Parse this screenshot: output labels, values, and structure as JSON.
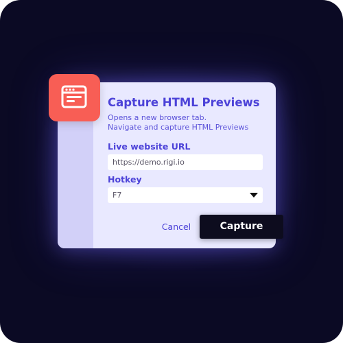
{
  "dialog": {
    "title": "Capture HTML Previews",
    "description_line1": "Opens a new browser tab.",
    "description_line2": "Navigate and capture HTML Previews",
    "icon": "browser-window-icon"
  },
  "form": {
    "url_label": "Live website URL",
    "url_value": "https://demo.rigi.io",
    "hotkey_label": "Hotkey",
    "hotkey_value": "F7"
  },
  "actions": {
    "cancel_label": "Cancel",
    "capture_label": "Capture"
  },
  "colors": {
    "background": "#0b0a24",
    "card": "#e9e9ff",
    "accent": "#4c42d8",
    "icon_tile": "#f85e55",
    "primary_button": "#0d0c1e"
  }
}
